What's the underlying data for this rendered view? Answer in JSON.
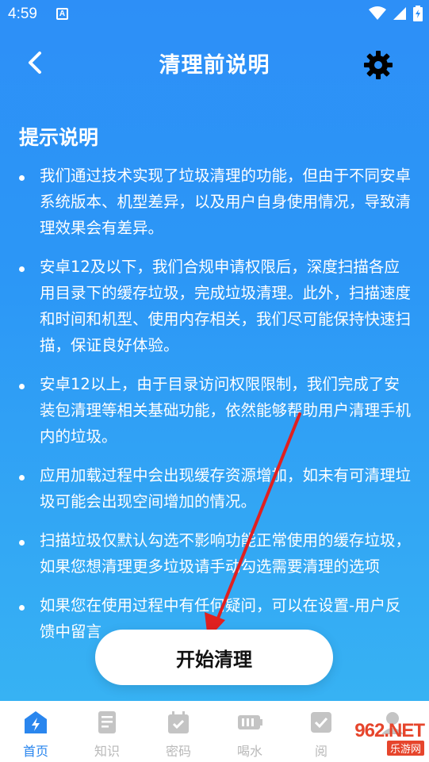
{
  "status_bar": {
    "time": "4:59",
    "notification_icon_letter": "A",
    "icons": [
      "wifi-icon",
      "signal-icon",
      "battery-icon"
    ]
  },
  "header": {
    "title": "清理前说明",
    "back_icon": "chevron-left-icon",
    "settings_icon": "gear-icon"
  },
  "content": {
    "section_title": "提示说明",
    "notes": [
      "我们通过技术实现了垃圾清理的功能，但由于不同安卓系统版本、机型差异，以及用户自身使用情况，导致清理效果会有差异。",
      "安卓12及以下，我们合规申请权限后，深度扫描各应用目录下的缓存垃圾，完成垃圾清理。此外，扫描速度和时间和机型、使用内存相关，我们尽可能保持快速扫描，保证良好体验。",
      "安卓12以上，由于目录访问权限限制，我们完成了安装包清理等相关基础功能，依然能够帮助用户清理手机内的垃圾。",
      "应用加载过程中会出现缓存资源增加，如未有可清理垃圾可能会出现空间增加的情况。",
      "扫描垃圾仅默认勾选不影响功能正常使用的缓存垃圾，如果您想清理更多垃圾请手动勾选需要清理的选项",
      "如果您在使用过程中有任何疑问，可以在设置-用户反馈中留言"
    ],
    "start_button": "开始清理"
  },
  "bottom_nav": {
    "items": [
      {
        "label": "首页",
        "icon": "home-bolt-icon",
        "active": true
      },
      {
        "label": "知识",
        "icon": "document-icon",
        "active": false
      },
      {
        "label": "密码",
        "icon": "calendar-check-icon",
        "active": false
      },
      {
        "label": "喝水",
        "icon": "battery-level-icon",
        "active": false
      },
      {
        "label": "阅",
        "icon": "checkbox-icon",
        "active": false
      },
      {
        "label": "",
        "icon": "profile-icon",
        "active": false
      }
    ]
  },
  "watermark": {
    "text": "962.NET",
    "subtext": "乐游网"
  },
  "colors": {
    "background_top": "#2d8ff7",
    "background_bottom": "#37b2f3",
    "nav_active": "#2a86ee",
    "nav_inactive": "#b9b9b9",
    "annotation_arrow": "#e02020"
  }
}
